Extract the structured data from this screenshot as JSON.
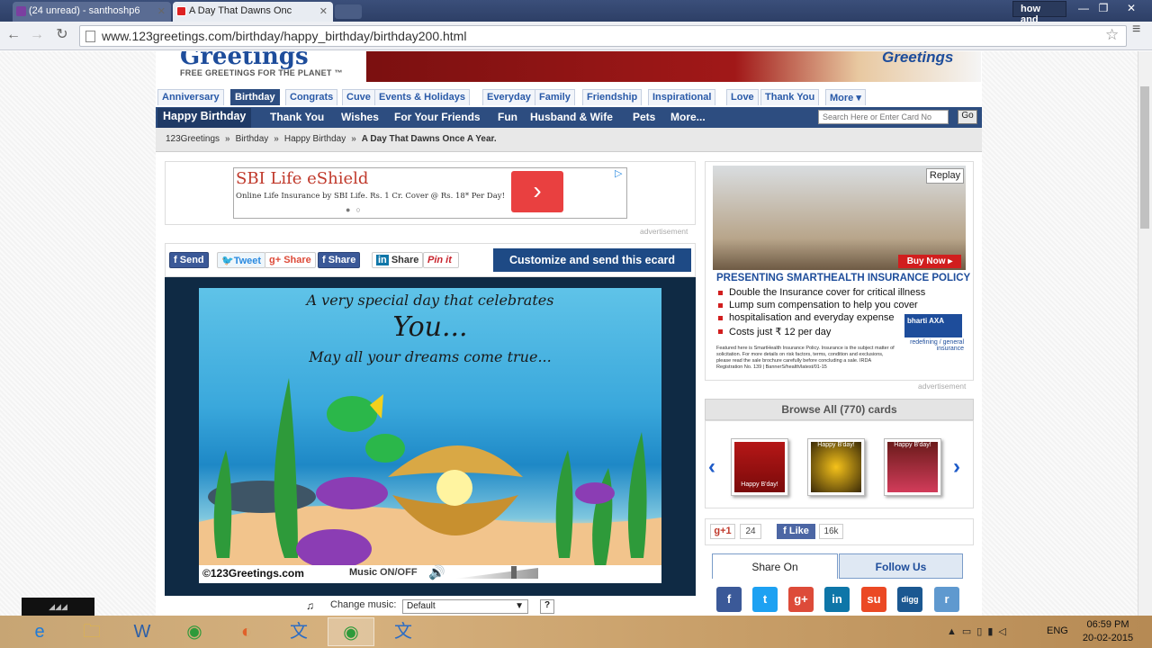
{
  "browser": {
    "tabs": [
      {
        "label": "(24 unread) - santhoshp6"
      },
      {
        "label": "A Day That Dawns Onc"
      }
    ],
    "corner_label": "how and",
    "url": "www.123greetings.com/birthday/happy_birthday/birthday200.html"
  },
  "site": {
    "logo": "Greetings",
    "tagline": "FREE GREETINGS FOR THE PLANET ™",
    "banner_logo": "Greetings",
    "topnav": [
      "Anniversary",
      "Birthday",
      "Congrats",
      "Cuve",
      "Events & Holidays",
      "Everyday",
      "Family",
      "Friendship",
      "Inspirational",
      "Love",
      "Thank You",
      "More ▾"
    ],
    "subnav": [
      "Happy Birthday",
      "Thank You",
      "Wishes",
      "For Your Friends",
      "Fun",
      "Husband & Wife",
      "Pets",
      "More..."
    ],
    "search_placeholder": "Search Here or Enter Card No",
    "go": "Go",
    "breadcrumb": [
      "123Greetings",
      "Birthday",
      "Happy Birthday",
      "A Day That Dawns Once A Year."
    ],
    "crumb_sep": "»"
  },
  "ad": {
    "title": "SBI Life eShield",
    "subtitle": "Online Life Insurance by SBI Life. Rs. 1 Cr. Cover @ Rs. 18* Per Day!",
    "label": "advertisement"
  },
  "share": {
    "send": "Send",
    "tweet": "Tweet",
    "gshare": "Share",
    "share": "Share",
    "in_share": "Share",
    "pinit": "Pin it",
    "customize": "Customize and send this ecard"
  },
  "ecard": {
    "line1": "A very special day that celebrates",
    "line2": "You...",
    "line3": "May all your dreams come true...",
    "copyright": "©123Greetings.com",
    "music_label": "Music",
    "onoff": "ON/OFF",
    "change_music": "Change music:",
    "music_value": "Default",
    "help": "?"
  },
  "rightad": {
    "replay": "Replay",
    "buy": "Buy Now ▸",
    "title": "PRESENTING  SMARTHEALTH INSURANCE POLICY",
    "bullets": [
      "Double the Insurance cover for critical illness",
      "Lump sum compensation to help you  cover",
      "hospitalisation and everyday expense",
      "Costs just ₹ 12 per day"
    ],
    "fine": "Featured here is SmartHealth Insurance Policy. Insurance is the subject matter of solicitation. For more details on risk factors, terms, condition and exclusions, please read the sale brochure carefully before concluding a sale. IRDA Registration No. 139 | BannerS/health/latest/01-15",
    "brand": "bharti AXA",
    "brand_tag": "redefining / general insurance",
    "label": "advertisement"
  },
  "browse": {
    "title": "Browse All (770) cards",
    "thumbs": [
      "Happy B'day!",
      "Happy B'day!",
      "Happy B'day!"
    ]
  },
  "social": {
    "gplus": "g+1",
    "gcount": "24",
    "like": "Like",
    "fbcount": "16k",
    "tab_share": "Share On",
    "tab_follow": "Follow Us",
    "icons": [
      {
        "name": "facebook-icon",
        "glyph": "f",
        "color": "#3b5998"
      },
      {
        "name": "twitter-icon",
        "glyph": "t",
        "color": "#1da1f2"
      },
      {
        "name": "google-plus-icon",
        "glyph": "g+",
        "color": "#dd4b39"
      },
      {
        "name": "linkedin-icon",
        "glyph": "in",
        "color": "#0e76a8"
      },
      {
        "name": "stumbleupon-icon",
        "glyph": "su",
        "color": "#eb4924"
      },
      {
        "name": "digg-icon",
        "glyph": "digg",
        "color": "#1b5891"
      },
      {
        "name": "reddit-icon",
        "glyph": "r",
        "color": "#5f99cf"
      }
    ]
  },
  "taskbar": {
    "lang": "ENG",
    "time": "06:59 PM",
    "date": "20-02-2015"
  }
}
